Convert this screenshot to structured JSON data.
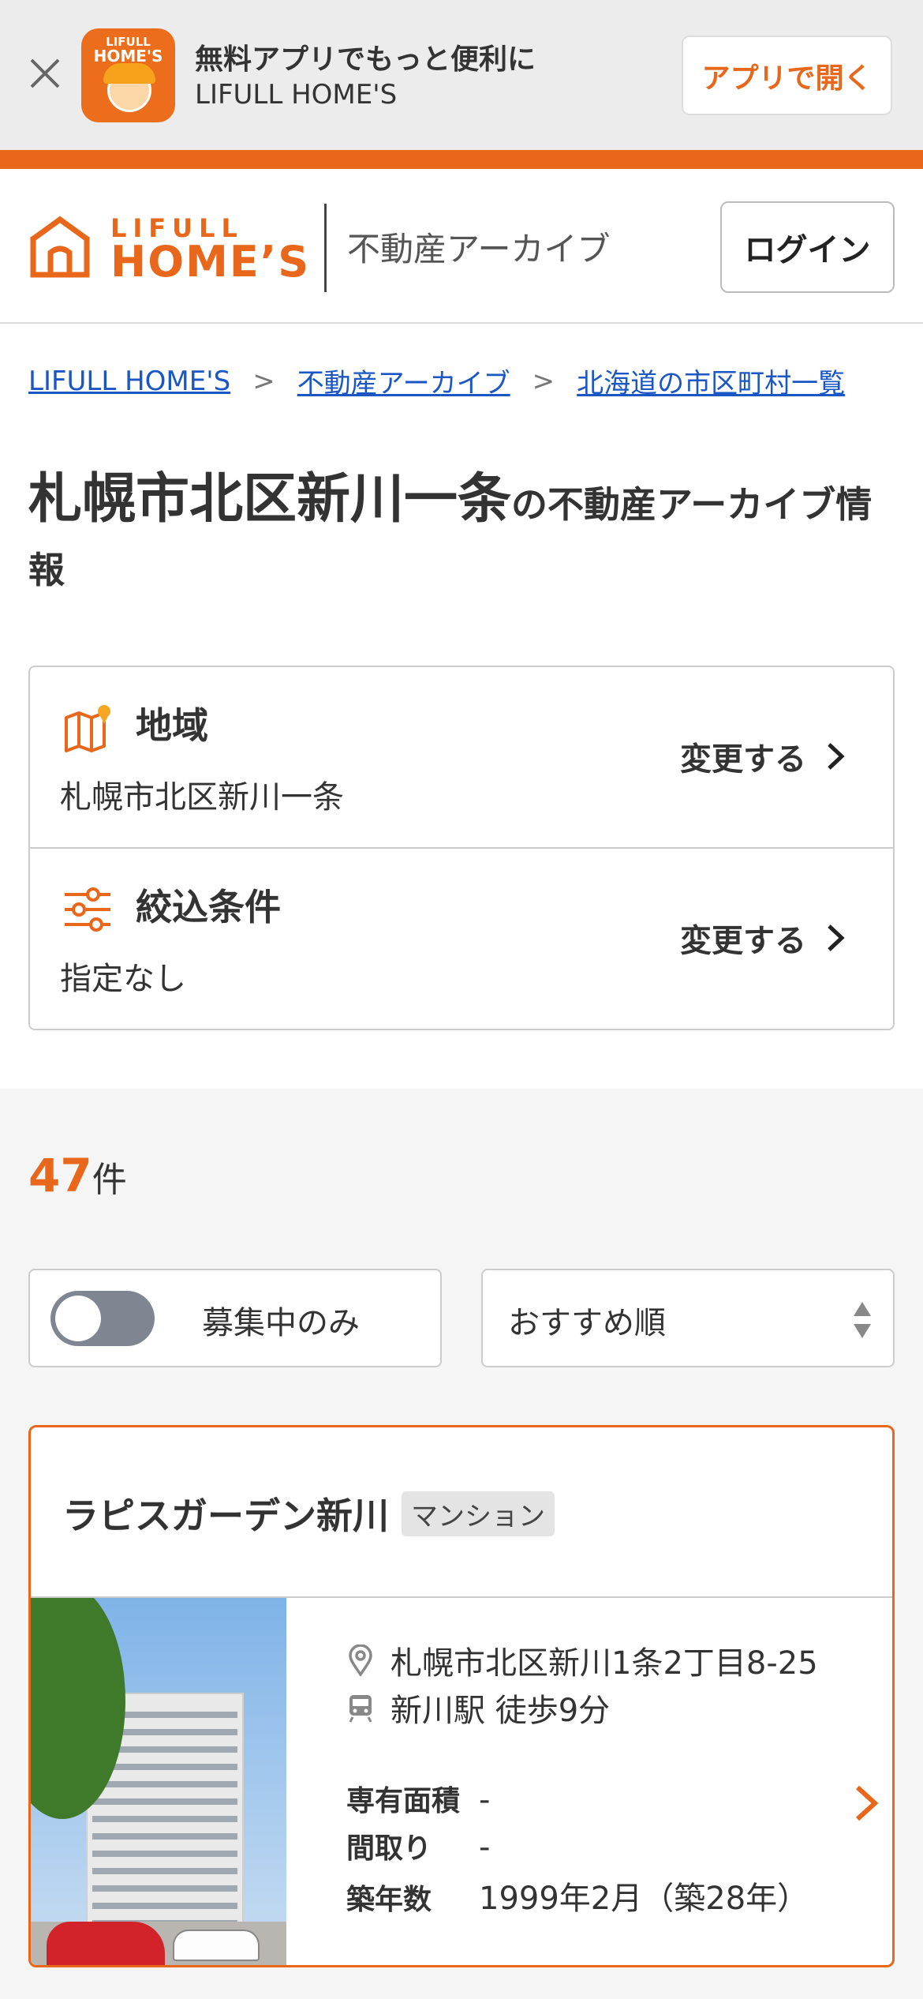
{
  "app_banner": {
    "title": "無料アプリでもっと便利に",
    "subtitle": "LIFULL HOME'S",
    "open_button": "アプリで開く",
    "icon_brand_top": "LIFULL",
    "icon_brand_bottom": "HOME'S"
  },
  "header": {
    "logo_top": "LIFULL",
    "logo_bottom": "HOME’S",
    "section_title": "不動産アーカイブ",
    "login_button": "ログイン"
  },
  "breadcrumb": [
    "LIFULL HOME'S",
    "不動産アーカイブ",
    "北海道の市区町村一覧"
  ],
  "breadcrumb_sep": ">",
  "page_title": {
    "main": "札幌市北区新川一条",
    "suffix": "の不動産アーカイブ情報"
  },
  "filters": {
    "area": {
      "label": "地域",
      "value": "札幌市北区新川一条",
      "change": "変更する"
    },
    "conditions": {
      "label": "絞込条件",
      "value": "指定なし",
      "change": "変更する"
    }
  },
  "results": {
    "count": "47",
    "unit": "件",
    "recruiting_only_label": "募集中のみ",
    "recruiting_only_on": false,
    "sort_label": "おすすめ順"
  },
  "listing": {
    "name": "ラピスガーデン新川",
    "type": "マンション",
    "address": "札幌市北区新川1条2丁目8-25",
    "access": "新川駅 徒歩9分",
    "specs": [
      {
        "key": "専有面積",
        "value": "-"
      },
      {
        "key": "間取り",
        "value": "-"
      },
      {
        "key": "築年数",
        "value": "1999年2月（築28年）"
      }
    ]
  },
  "colors": {
    "accent": "#e8671b",
    "link": "#1a56c4"
  }
}
